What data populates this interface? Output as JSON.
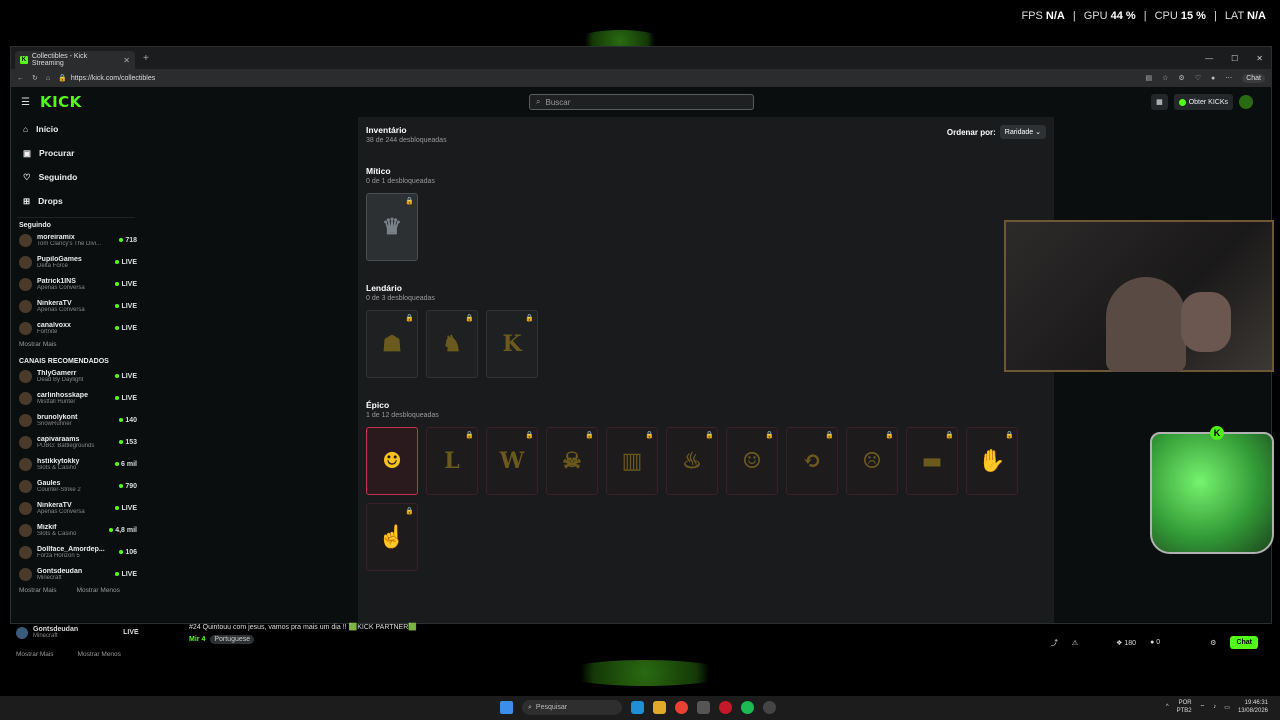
{
  "overlay": {
    "fps_label": "FPS",
    "fps_value": "N/A",
    "gpu_label": "GPU",
    "gpu_value": "44 %",
    "cpu_label": "CPU",
    "cpu_value": "15 %",
    "lat_label": "LAT",
    "lat_value": "N/A"
  },
  "browser": {
    "tab_title": "Collectibles - Kick Streaming",
    "url": "https://kick.com/collectibles",
    "chat_label": "Chat"
  },
  "header": {
    "logo": "KICK",
    "search_placeholder": "Buscar",
    "kicks_button": "Obter KICKs"
  },
  "sidebar": {
    "nav": [
      {
        "label": "Início",
        "icon": "home-icon"
      },
      {
        "label": "Procurar",
        "icon": "browse-icon"
      },
      {
        "label": "Seguindo",
        "icon": "heart-icon"
      },
      {
        "label": "Drops",
        "icon": "gift-icon"
      }
    ],
    "following_title": "Seguindo",
    "following": [
      {
        "name": "moreiramix",
        "game": "Tom Clancy's The Divi...",
        "status": "718"
      },
      {
        "name": "PupiloGames",
        "game": "Delta Force",
        "status": "LIVE"
      },
      {
        "name": "Patrick1INS",
        "game": "Apenas Conversa",
        "status": "LIVE"
      },
      {
        "name": "NinkeraTV",
        "game": "Apenas Conversa",
        "status": "LIVE"
      },
      {
        "name": "canalvoxx",
        "game": "Fortnite",
        "status": "LIVE"
      }
    ],
    "show_more": "Mostrar Mais",
    "recommended_title": "CANAIS RECOMENDADOS",
    "recommended": [
      {
        "name": "ThlyGamerr",
        "game": "Dead By Daylight",
        "status": "LIVE"
      },
      {
        "name": "carlinhosskape",
        "game": "Mistfall Hunter",
        "status": "LIVE"
      },
      {
        "name": "brunolykont",
        "game": "SnowRunner",
        "status": "140"
      },
      {
        "name": "capivaraams",
        "game": "PUBG: Battlegrounds",
        "status": "153"
      },
      {
        "name": "hstikkytokky",
        "game": "Slots & Casino",
        "status": "6 mil"
      },
      {
        "name": "Gaules",
        "game": "Counter-Strike 2",
        "status": "790"
      },
      {
        "name": "NinkeraTV",
        "game": "Apenas Conversa",
        "status": "LIVE"
      },
      {
        "name": "Mizkif",
        "game": "Slots & Casino",
        "status": "4,8 mil"
      },
      {
        "name": "Dollface_Amordep...",
        "game": "Forza Horizon 5",
        "status": "106"
      },
      {
        "name": "Gontsdeudan",
        "game": "Minecraft",
        "status": "LIVE"
      }
    ],
    "rec_show_more": "Mostrar Mais",
    "rec_show_less": "Mostrar Menos"
  },
  "main": {
    "title": "Inventário",
    "subtitle": "38 de 244 desbloqueadas",
    "sort_label": "Ordenar por:",
    "sort_value": "Raridade",
    "groups": [
      {
        "name": "Mítico",
        "count": "0 de 1 desbloqueadas"
      },
      {
        "name": "Lendário",
        "count": "0 de 3 desbloqueadas"
      },
      {
        "name": "Épico",
        "count": "1 de 12 desbloqueadas"
      }
    ]
  },
  "stream_bar": {
    "streamer": "Gontsdeudan",
    "game": "Minecraft",
    "status": "LIVE",
    "show_more": "Mostrar Mais",
    "show_less": "Mostrar Menos",
    "stream_title": "#24 Quintouu com jesus, vamos pra mais um dia !! 🟩KICK PARTNER🟩",
    "category": "Mir 4",
    "language_tag": "Portuguese",
    "kicks_count": "180",
    "coins_count": "0",
    "chat_button": "Chat"
  },
  "taskbar": {
    "search_placeholder": "Pesquisar",
    "lang": "POR",
    "layout": "PTB2",
    "time": "19:46:31",
    "date": "13/08/2026"
  }
}
